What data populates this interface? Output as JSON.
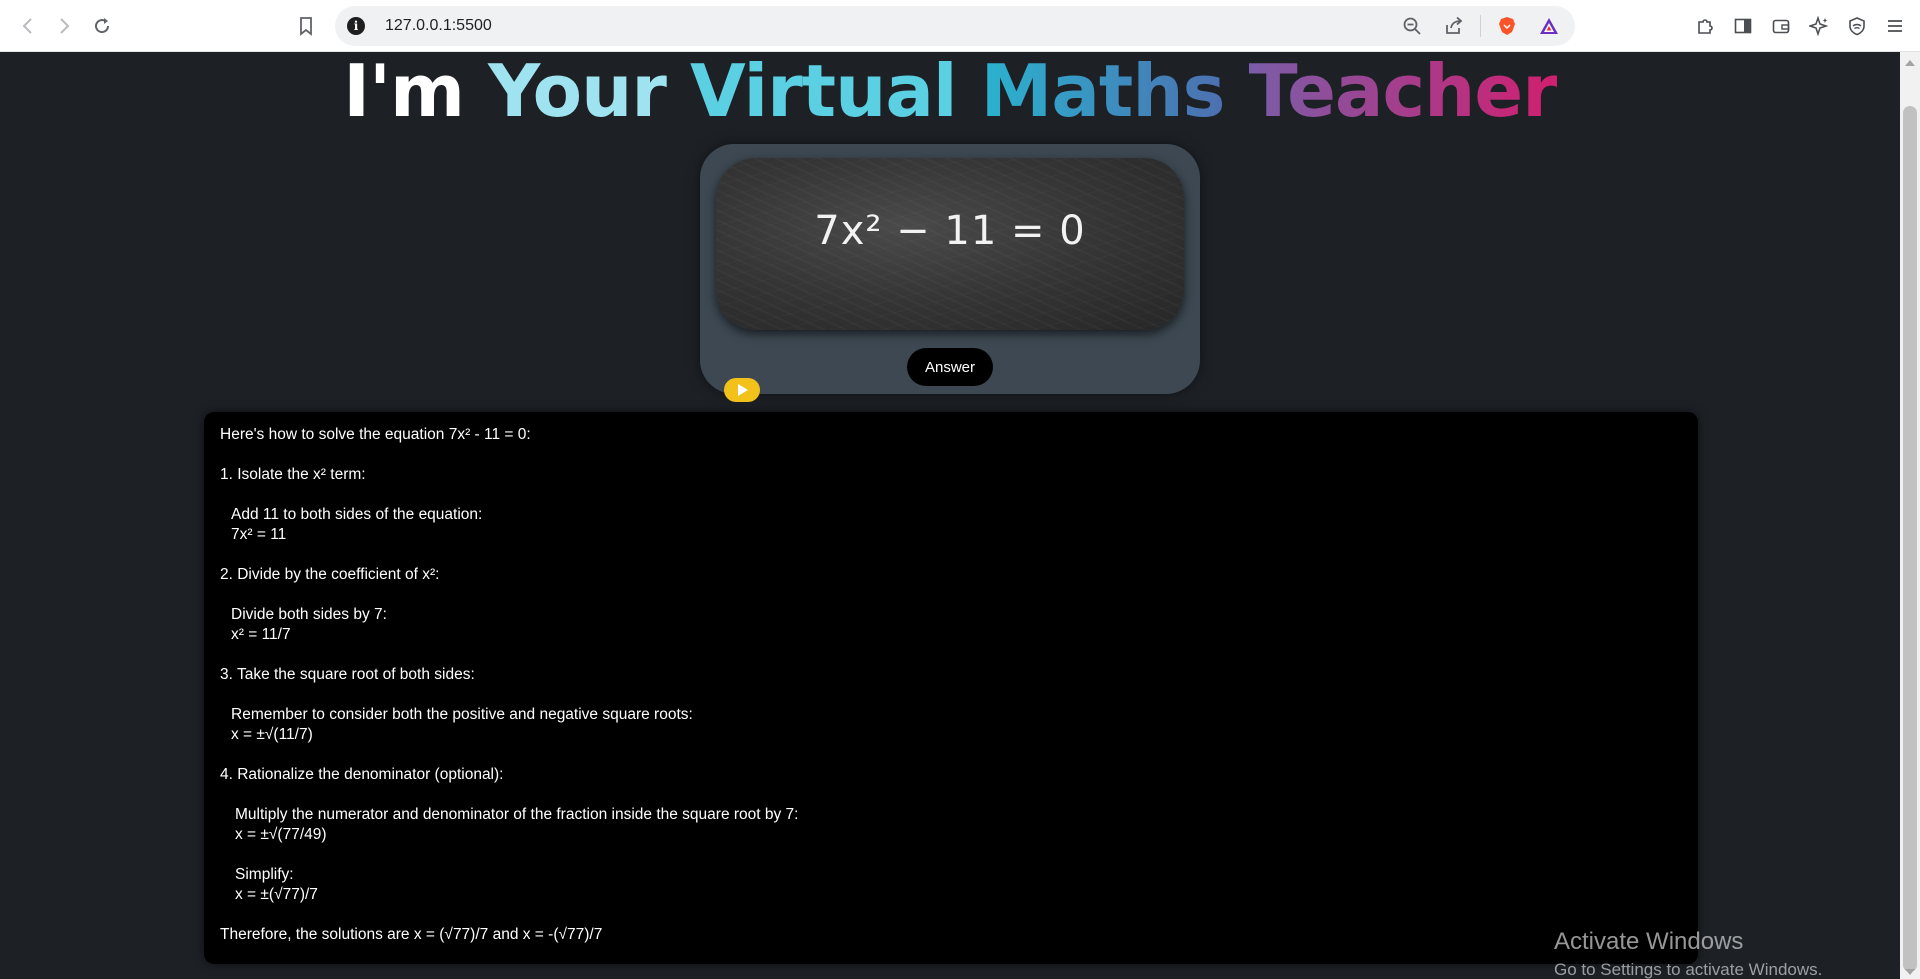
{
  "browser": {
    "url": "127.0.0.1:5500"
  },
  "page": {
    "title_words": [
      "I'm",
      "Your",
      "Virtual",
      "Maths",
      "Teacher"
    ],
    "equation": "7x² − 11 = 0",
    "answer_button": "Answer",
    "solution_lines": [
      "Here's how to solve the equation 7x² - 11 = 0:",
      "1. Isolate the x² term:",
      "Add 11 to both sides of the equation:",
      "7x² = 11",
      "2. Divide by the coefficient of x²:",
      "Divide both sides by 7:",
      "x² = 11/7",
      "3. Take the square root of both sides:",
      "Remember to consider both the positive and negative square roots:",
      "x = ±√(11/7)",
      "4. Rationalize the denominator (optional):",
      "Multiply the numerator and denominator of the fraction inside the square root by 7:",
      "x = ±√(77/49)",
      "Simplify:",
      "x = ±(√77)/7",
      "Therefore, the solutions are x = (√77)/7 and x = -(√77)/7"
    ]
  },
  "watermark": {
    "line1": "Activate Windows",
    "line2": "Go to Settings to activate Windows."
  },
  "colors": {
    "background": "#1d2126",
    "card": "#3d4852",
    "play_button": "#f2c21b"
  }
}
